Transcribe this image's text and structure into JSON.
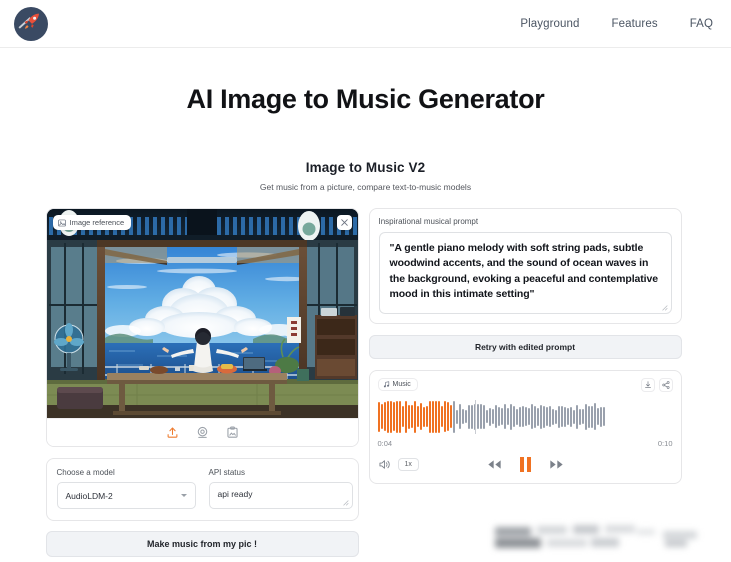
{
  "header": {
    "logo_icon": "rocket-logo-icon",
    "nav": [
      {
        "label": "Playground"
      },
      {
        "label": "Features"
      },
      {
        "label": "FAQ"
      }
    ]
  },
  "page": {
    "title": "AI Image to Music Generator"
  },
  "app": {
    "title": "Image to Music V2",
    "subtitle": "Get music from a picture, compare text-to-music models"
  },
  "image_panel": {
    "badge_label": "Image reference",
    "badge_icon": "image-icon",
    "close_icon": "close-icon",
    "tools": [
      {
        "name": "upload-icon",
        "color": "#ee7b2e"
      },
      {
        "name": "webcam-icon",
        "color": "#9aa0a8"
      },
      {
        "name": "paste-clipboard-icon",
        "color": "#9aa0a8"
      }
    ],
    "alt": "Anime illustration of a girl in a white dress kneeling on a table with arms outstretched toward a bright cumulus cloud over the ocean, seen from inside a traditional Japanese room"
  },
  "model_row": {
    "model_label": "Choose a model",
    "model_value": "AudioLDM-2",
    "model_options": [
      "AudioLDM-2"
    ],
    "api_label": "API status",
    "api_value": "api ready"
  },
  "generate_button": {
    "label": "Make music from my pic !"
  },
  "prompt": {
    "label": "Inspirational musical prompt",
    "value": "\"A gentle piano melody with soft string pads, subtle woodwind accents, and the sound of ocean waves in the background, evoking a peaceful and contemplative mood in this intimate setting\"",
    "retry_label": "Retry with edited prompt"
  },
  "player": {
    "chip_label": "Music",
    "chip_icon": "music-note-icon",
    "download_icon": "download-icon",
    "share_icon": "share-icon",
    "current_time": "0:04",
    "total_time": "0:10",
    "volume_icon": "volume-icon",
    "speed_label": "1x",
    "rewind_icon": "skip-back-icon",
    "pause_icon": "pause-icon",
    "forward_icon": "skip-forward-icon",
    "progress_percent": 33,
    "played_color": "#f07222",
    "remaining_color": "#9aa1ad"
  }
}
